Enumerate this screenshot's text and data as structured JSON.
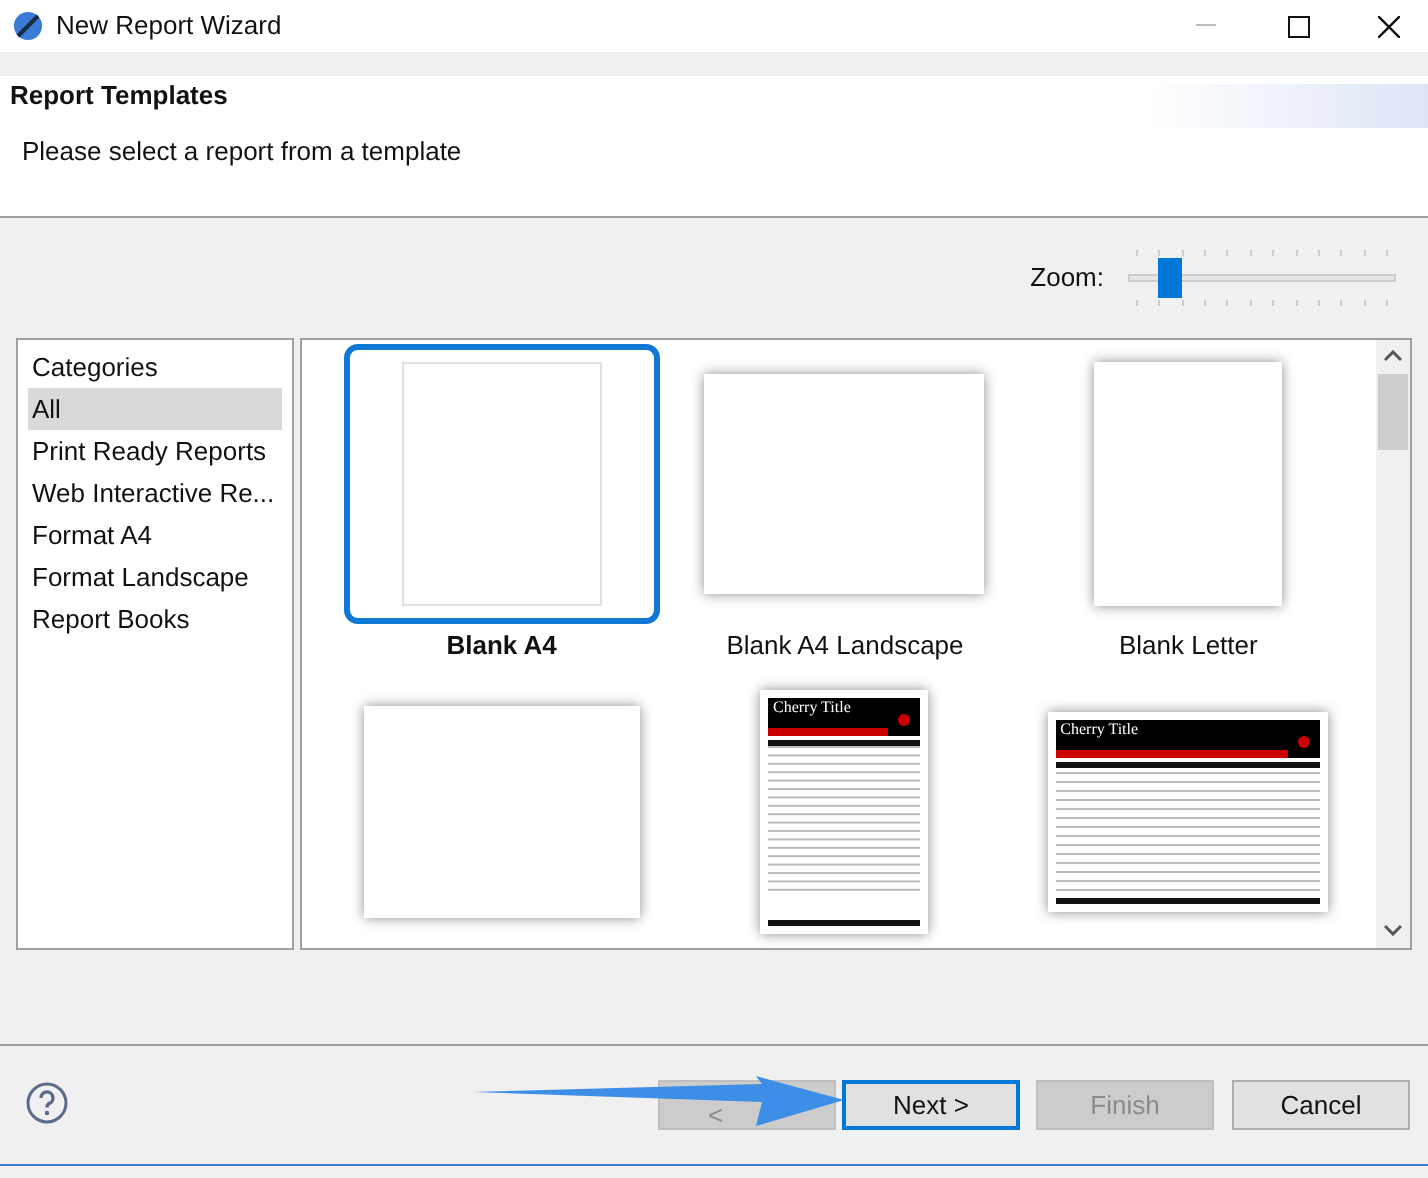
{
  "window": {
    "title": "New Report Wizard"
  },
  "header": {
    "title": "Report Templates",
    "description": "Please select a report from a template"
  },
  "zoom": {
    "label": "Zoom:",
    "level": 0.1
  },
  "categories": {
    "heading": "Categories",
    "items": [
      {
        "label": "All",
        "selected": true
      },
      {
        "label": "Print Ready Reports",
        "selected": false
      },
      {
        "label": "Web Interactive Re...",
        "selected": false
      },
      {
        "label": "Format A4",
        "selected": false
      },
      {
        "label": "Format Landscape",
        "selected": false
      },
      {
        "label": "Report Books",
        "selected": false
      }
    ]
  },
  "templates": [
    {
      "label": "Blank A4",
      "kind": "portrait",
      "selected": true
    },
    {
      "label": "Blank A4 Landscape",
      "kind": "landscape",
      "selected": false
    },
    {
      "label": "Blank Letter",
      "kind": "letter",
      "selected": false
    },
    {
      "kind": "landscape-small",
      "selected": false
    },
    {
      "kind": "cherry-portrait",
      "title": "Cherry Title",
      "selected": false
    },
    {
      "kind": "cherry-landscape",
      "title": "Cherry Title",
      "selected": false
    }
  ],
  "buttons": [
    {
      "label": "<",
      "disabled": true,
      "focused": false
    },
    {
      "label": "Next >",
      "disabled": false,
      "focused": true
    },
    {
      "label": "Finish",
      "disabled": true,
      "focused": false
    },
    {
      "label": "Cancel",
      "disabled": false,
      "focused": false
    }
  ]
}
